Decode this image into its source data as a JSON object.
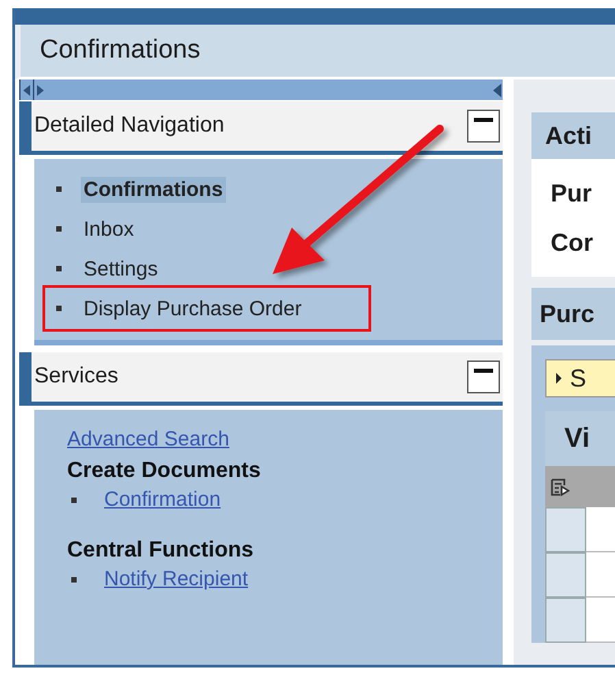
{
  "window": {
    "title": "Confirmations"
  },
  "detailed_navigation": {
    "title": "Detailed Navigation",
    "expanded": true,
    "items": [
      {
        "label": "Confirmations",
        "selected": true,
        "highlighted": false
      },
      {
        "label": "Inbox",
        "selected": false,
        "highlighted": false
      },
      {
        "label": "Settings",
        "selected": false,
        "highlighted": false
      },
      {
        "label": "Display Purchase Order",
        "selected": false,
        "highlighted": true
      }
    ]
  },
  "services": {
    "title": "Services",
    "expanded": true,
    "link": "Advanced Search",
    "groups": [
      {
        "title": "Create Documents",
        "links": [
          "Confirmation"
        ]
      },
      {
        "title": "Central Functions",
        "links": [
          "Notify Recipient"
        ]
      }
    ]
  },
  "content": {
    "activities": {
      "title": "Acti",
      "lines": [
        "Pur",
        "Cor"
      ]
    },
    "purchase": {
      "title": "Purc",
      "button": "S",
      "view": "Vi"
    }
  }
}
